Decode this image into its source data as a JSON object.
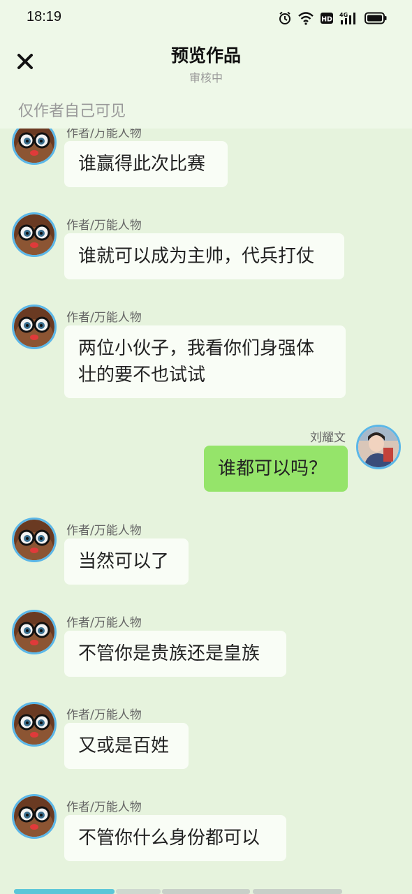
{
  "status_bar": {
    "time": "18:19",
    "icons": [
      "alarm-icon",
      "wifi-icon",
      "hd-icon",
      "4g-signal-icon",
      "battery-icon"
    ],
    "hd_label": "HD",
    "network_label": "4G"
  },
  "header": {
    "title": "预览作品",
    "subtitle": "审核中",
    "close_icon": "close-icon",
    "visibility_note": "仅作者自己可见"
  },
  "messages": [
    {
      "side": "left",
      "sender": "作者/万能人物",
      "text": "谁赢得此次比赛",
      "avatar": "cartoon-character-avatar"
    },
    {
      "side": "left",
      "sender": "作者/万能人物",
      "text": "谁就可以成为主帅，代兵打仗",
      "avatar": "cartoon-character-avatar"
    },
    {
      "side": "left",
      "sender": "作者/万能人物",
      "text_lines": [
        "两位小伙子，我看你们身强体",
        "壮的要不也试试"
      ],
      "avatar": "cartoon-character-avatar"
    },
    {
      "side": "right",
      "sender": "刘耀文",
      "text": "谁都可以吗？",
      "avatar": "user-photo-avatar"
    },
    {
      "side": "left",
      "sender": "作者/万能人物",
      "text": "当然可以了",
      "avatar": "cartoon-character-avatar"
    },
    {
      "side": "left",
      "sender": "作者/万能人物",
      "text": "不管你是贵族还是皇族",
      "avatar": "cartoon-character-avatar"
    },
    {
      "side": "left",
      "sender": "作者/万能人物",
      "text": "又或是百姓",
      "avatar": "cartoon-character-avatar"
    },
    {
      "side": "left",
      "sender": "作者/万能人物",
      "text": "不管你什么身份都可以",
      "avatar": "cartoon-character-avatar"
    }
  ],
  "colors": {
    "background": "#e6f3dd",
    "header_background": "#eef8e8",
    "left_bubble": "#f9fdf6",
    "right_bubble": "#95e46a",
    "avatar_border": "#5bb7e8"
  }
}
